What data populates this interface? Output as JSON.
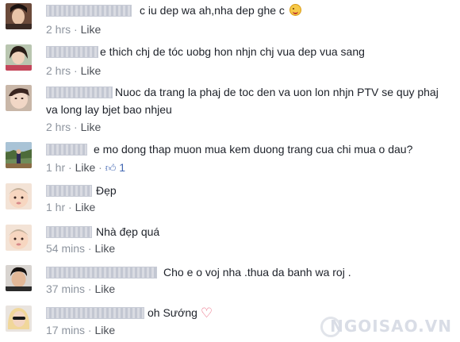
{
  "comments": [
    {
      "text": "c iu dep wa ah,nha dep ghe c",
      "time": "2 hrs",
      "like": "Like",
      "emoji": "wink-emoji"
    },
    {
      "text": "e thich chj de tóc uobg hon nhjn chj vua dep vua sang",
      "time": "2 hrs",
      "like": "Like"
    },
    {
      "text_line1": "Nuoc da trang la phaj de toc den va uon lon nhjn PTV se quy phaj",
      "text_line2": "va long lay bjet bao nhjeu",
      "time": "2 hrs",
      "like": "Like"
    },
    {
      "text": "e mo dong thap muon mua kem duong trang cua chi mua o dau?",
      "time": "1 hr",
      "like": "Like",
      "like_count": "1"
    },
    {
      "text": "Đẹp",
      "time": "1 hr",
      "like": "Like"
    },
    {
      "text": "Nhà đẹp quá",
      "time": "54 mins",
      "like": "Like"
    },
    {
      "text": "Cho e o voj nha .thua da banh wa roj .",
      "time": "37 mins",
      "like": "Like"
    },
    {
      "text": "oh Sướng",
      "time": "17 mins",
      "like": "Like",
      "emoji": "heart-emoji"
    }
  ],
  "separator": "·",
  "watermark": "NGOISAO.VN"
}
